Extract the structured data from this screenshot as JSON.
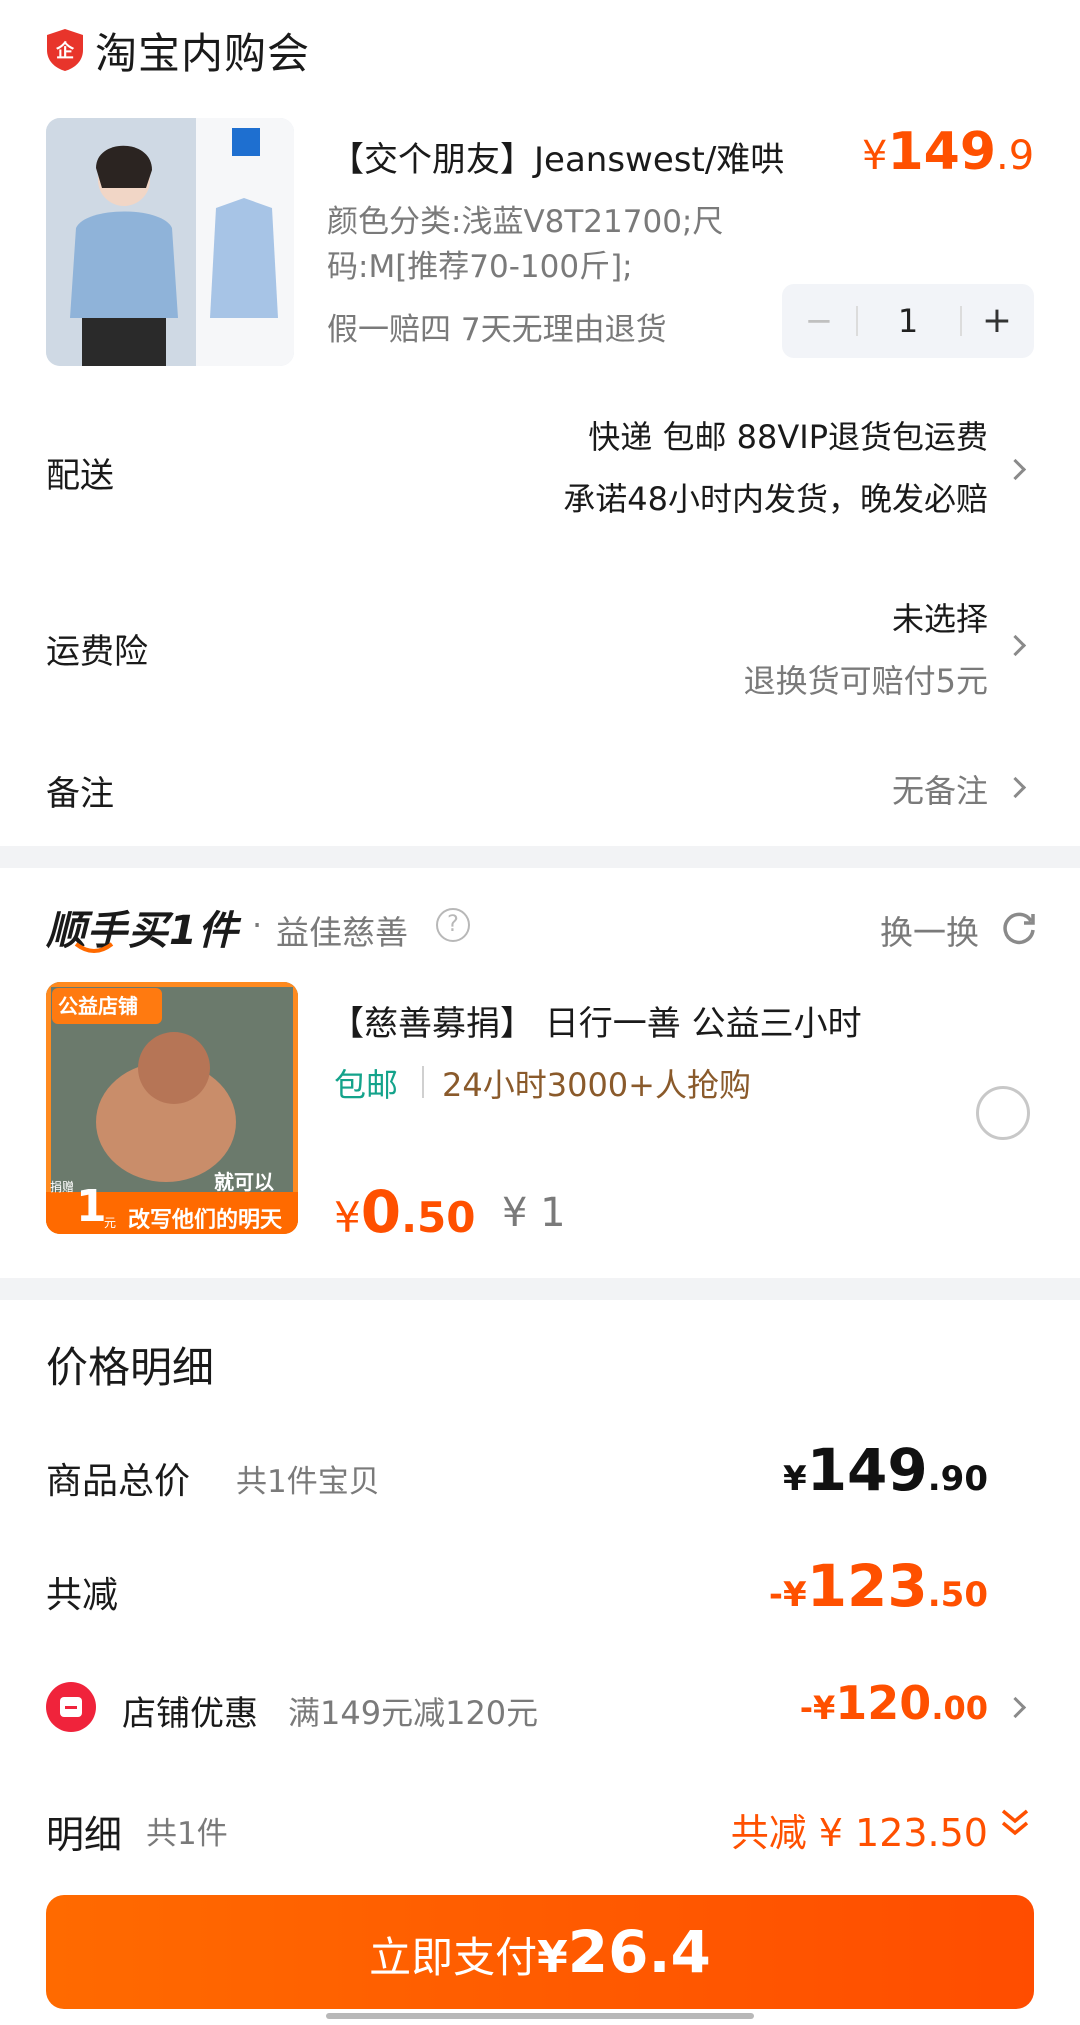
{
  "header": {
    "shop_name": "淘宝内购会",
    "badge_icon": "enterprise-shield-icon"
  },
  "product": {
    "title": "【交个朋友】Jeanswest/难哄",
    "price_yen": "¥",
    "price_int": "149",
    "price_dec": ".9",
    "spec": "颜色分类:浅蓝V8T21700;尺码:M[推荐70-100斤];",
    "tags": "假一赔四  7天无理由退货",
    "quantity": "1",
    "minus": "−",
    "plus": "+"
  },
  "delivery": {
    "label": "配送",
    "line1": "快递 包邮 88VIP退货包运费",
    "line2": "承诺48小时内发货，晚发必赔"
  },
  "shipping_insurance": {
    "label": "运费险",
    "line1": "未选择",
    "line2": "退换货可赔付5元"
  },
  "note": {
    "label": "备注",
    "value": "无备注"
  },
  "addon": {
    "brand": "顺手买1件",
    "dot": "·",
    "sub": "益佳慈善",
    "help_icon": "?",
    "refresh_label": "换一换",
    "item_title": "【慈善募捐】 日行一善  公益三小时",
    "free_ship": "包邮",
    "sales": "24小时3000+人抢购",
    "price_yen": "¥",
    "price_int": "0",
    "price_dec": ".50",
    "orig_price": "¥ 1",
    "img_badge": "公益店铺",
    "img_donate_label": "捐赠",
    "img_donate_amount": "1",
    "img_donate_unit": "元",
    "img_slogan1": "就可以",
    "img_slogan2": "改写他们的明天"
  },
  "price_detail": {
    "title": "价格明细",
    "total_label": "商品总价",
    "total_count": "共1件宝贝",
    "total_yen": "¥",
    "total_int": "149",
    "total_dec": ".90",
    "reduce_label": "共减",
    "reduce_prefix": "-¥",
    "reduce_int": "123",
    "reduce_dec": ".50",
    "store_label": "店铺优惠",
    "store_rule": "满149元减120元",
    "store_prefix": "-¥",
    "store_int": "120",
    "store_dec": ".00",
    "detail_label": "明细",
    "detail_count": "共1件",
    "detail_reduce": "共减 ¥ 123.50"
  },
  "pay_button": {
    "label": "立即支付",
    "yen": "¥",
    "amount": "26.4"
  },
  "colors": {
    "accent": "#ff5000",
    "free_ship_green": "#14a38b",
    "brown": "#8a5a2b"
  }
}
